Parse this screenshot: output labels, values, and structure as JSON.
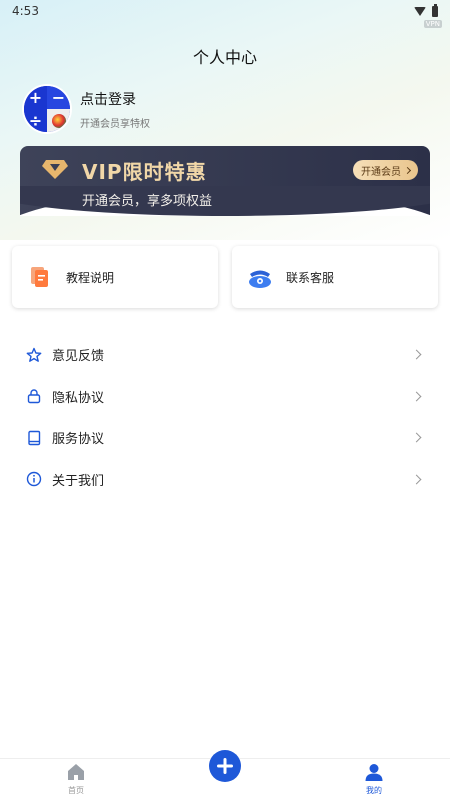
{
  "status_bar": {
    "time": "4:53",
    "vpn_label": "VPN"
  },
  "page": {
    "title": "个人中心"
  },
  "profile": {
    "login_label": "点击登录",
    "subtitle": "开通会员享特权",
    "avatar_symbols": [
      "+",
      "−",
      "÷"
    ]
  },
  "vip": {
    "title": "VIP限时特惠",
    "description": "开通会员，享多项权益",
    "button_label": "开通会员",
    "colors": {
      "card_bg": "#34384f",
      "gold": "#f1d7a8"
    }
  },
  "quick_cards": [
    {
      "label": "教程说明",
      "icon": "document-icon"
    },
    {
      "label": "联系客服",
      "icon": "telephone-icon"
    }
  ],
  "menu": [
    {
      "label": "意见反馈",
      "icon": "star-icon"
    },
    {
      "label": "隐私协议",
      "icon": "lock-icon"
    },
    {
      "label": "服务协议",
      "icon": "book-icon"
    },
    {
      "label": "关于我们",
      "icon": "info-icon"
    }
  ],
  "tabbar": {
    "home_label": "首页",
    "mine_label": "我的",
    "active_color": "#1e58d8",
    "inactive_color": "#999999"
  }
}
